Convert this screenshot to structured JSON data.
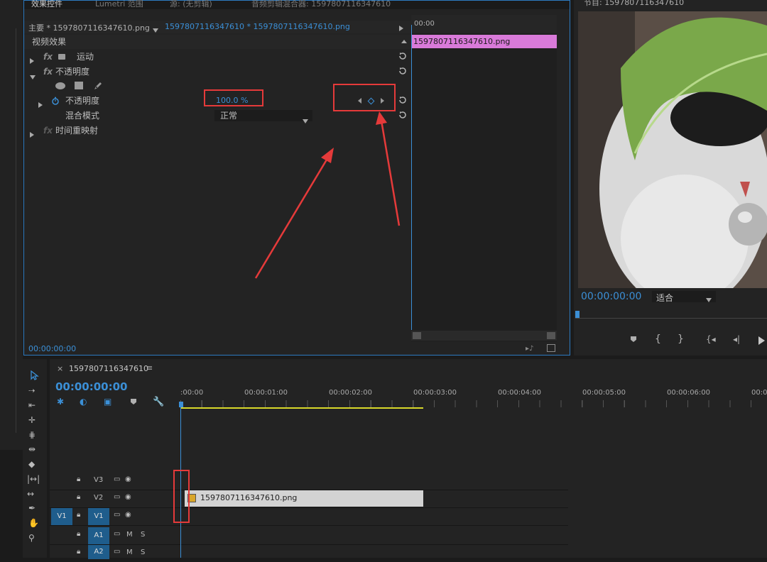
{
  "effects_panel": {
    "tabs": [
      "效果控件",
      "Lumetri 范围",
      "源: (无剪辑)",
      "音频剪辑混合器: 1597807116347610"
    ],
    "master_label": "主要 * 1597807116347610.png",
    "sequence_label": "1597807116347610 * 1597807116347610.png",
    "section_title": "视频效果",
    "effects": {
      "motion": "运动",
      "opacity": "不透明度",
      "opacity_param": "不透明度",
      "opacity_value": "100.0 %",
      "blend_mode_label": "混合模式",
      "blend_mode_value": "正常",
      "time_remap": "时间重映射"
    },
    "mini_timeline_start": "00:00",
    "clip_name": "1597807116347610.png",
    "footer_timecode": "00:00:00:00"
  },
  "program_monitor": {
    "title": "节目: 1597807116347610",
    "timecode": "00:00:00:00",
    "fit_label": "适合"
  },
  "timeline": {
    "sequence_name": "1597807116347610",
    "timecode": "00:00:00:00",
    "ruler": [
      ":00:00",
      "00:00:01:00",
      "00:00:02:00",
      "00:00:03:00",
      "00:00:04:00",
      "00:00:05:00",
      "00:00:06:00",
      "00:0"
    ],
    "tracks": [
      {
        "name": "V3",
        "source": ""
      },
      {
        "name": "V2",
        "source": ""
      },
      {
        "name": "V1",
        "source": "V1"
      },
      {
        "name": "A1",
        "source": ""
      },
      {
        "name": "A2",
        "source": ""
      }
    ],
    "clip_label": "1597807116347610.png",
    "mute_label": "M",
    "solo_label": "S"
  },
  "colors": {
    "accent_blue": "#3b8fd6",
    "clip_pink": "#d97ad9",
    "annotation_red": "#e53a3a",
    "track_active": "#1f5d8c"
  }
}
